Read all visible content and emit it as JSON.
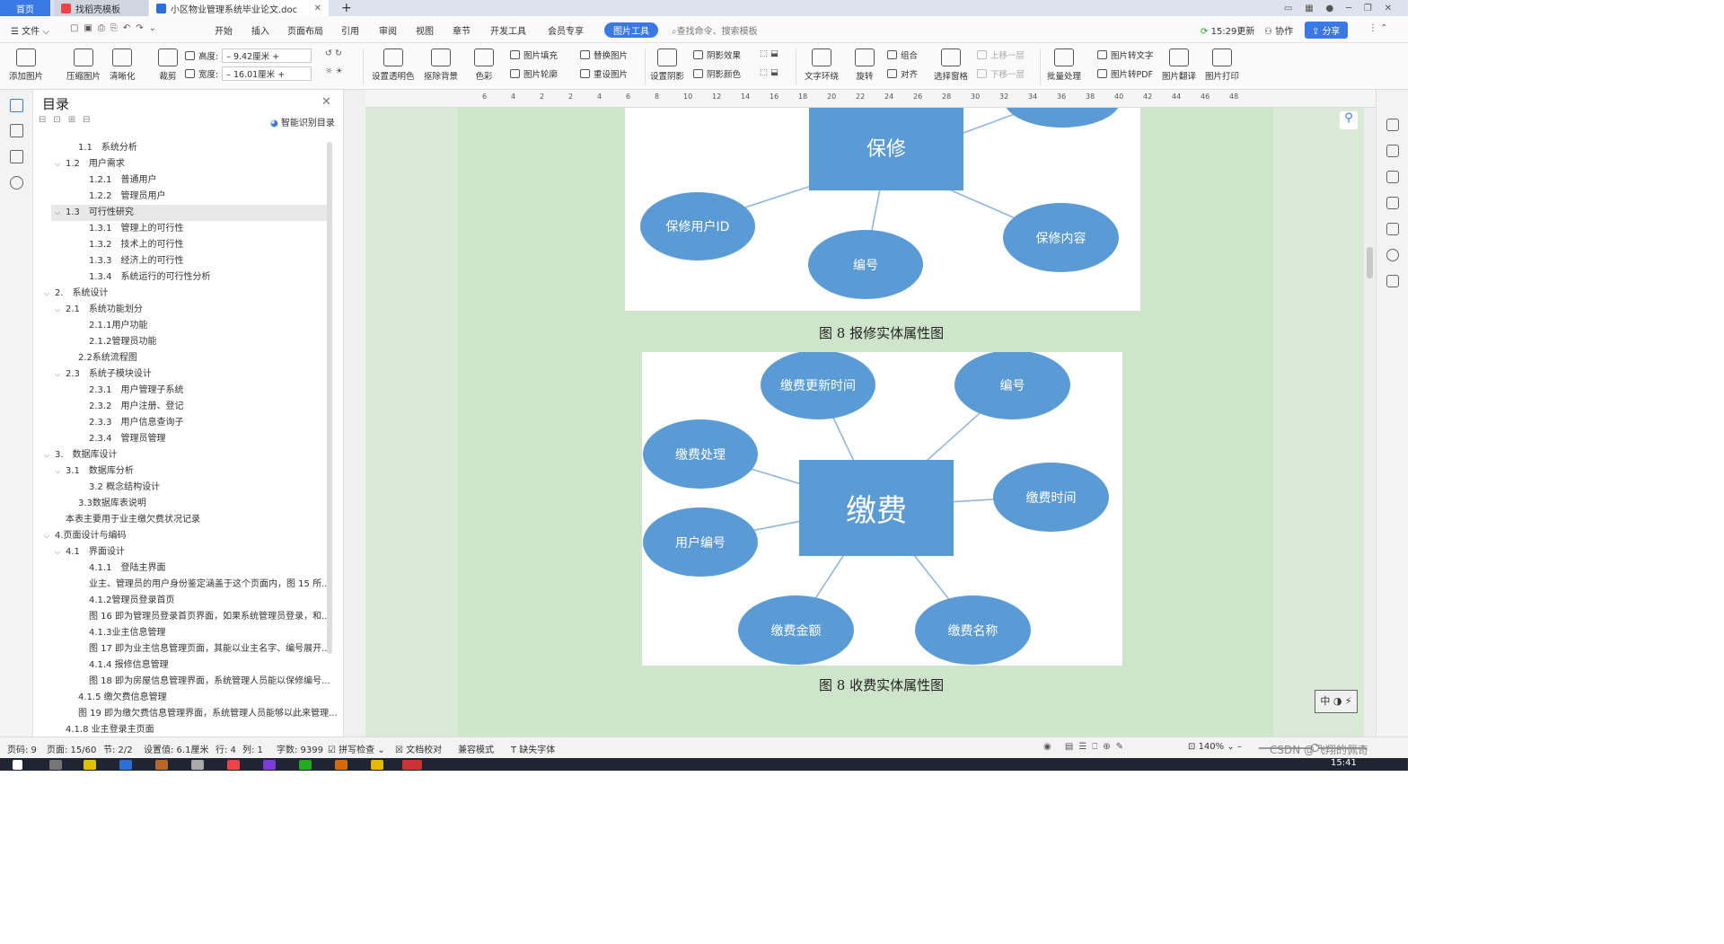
{
  "tabs": {
    "home": "首页",
    "template": "找稻壳模板",
    "document": "小区物业管理系统毕业论文.doc",
    "close": "✕",
    "new": "+"
  },
  "menu": {
    "file": "文件",
    "items": [
      "开始",
      "插入",
      "页面布局",
      "引用",
      "审阅",
      "视图",
      "章节",
      "开发工具",
      "会员专享"
    ],
    "active": "图片工具",
    "search_placeholder": "查找命令、搜索模板",
    "update": "15:29更新",
    "collab": "协作",
    "share": "分享"
  },
  "ribbon": {
    "big": [
      "添加图片",
      "压缩图片",
      "清晰化",
      "裁剪",
      "设置透明色",
      "抠除背景",
      "色彩",
      "设置阴影",
      "文字环绕",
      "旋转",
      "选择窗格",
      "批量处理",
      "图片转文字",
      "图片翻译",
      "图片打印"
    ],
    "height_label": "高度:",
    "height_value": "9.42厘米",
    "width_label": "宽度:",
    "width_value": "16.01厘米",
    "small": [
      "图片填充",
      "图片轮廓",
      "替换图片",
      "重设图片",
      "阴影效果",
      "阴影颜色",
      "组合",
      "对齐",
      "上移一层",
      "下移一层",
      "图片转PDF"
    ]
  },
  "toc": {
    "title": "目录",
    "smart": "智能识别目录",
    "items": [
      {
        "text": "1.1　系统分析",
        "arrow": ""
      },
      {
        "text": "1.2　用户需求",
        "arrow": "v"
      },
      {
        "text": "1.2.1　普通用户",
        "arrow": ""
      },
      {
        "text": "1.2.2　管理员用户",
        "arrow": ""
      },
      {
        "text": "1.3　可行性研究",
        "arrow": "v"
      },
      {
        "text": "1.3.1　管理上的可行性",
        "arrow": ""
      },
      {
        "text": "1.3.2　技术上的可行性",
        "arrow": ""
      },
      {
        "text": "1.3.3　经济上的可行性",
        "arrow": ""
      },
      {
        "text": "1.3.4　系统运行的可行性分析",
        "arrow": ""
      },
      {
        "text": "2.　系统设计",
        "arrow": "v"
      },
      {
        "text": "2.1　系统功能划分",
        "arrow": "v"
      },
      {
        "text": "2.1.1用户功能",
        "arrow": ""
      },
      {
        "text": "2.1.2管理员功能",
        "arrow": ""
      },
      {
        "text": "2.2系统流程图",
        "arrow": ""
      },
      {
        "text": "2.3　系统子模块设计",
        "arrow": "v"
      },
      {
        "text": "2.3.1　用户管理子系统",
        "arrow": ""
      },
      {
        "text": "2.3.2　用户注册、登记",
        "arrow": ""
      },
      {
        "text": "2.3.3　用户信息查询子",
        "arrow": ""
      },
      {
        "text": "2.3.4　管理员管理",
        "arrow": ""
      },
      {
        "text": "3.　数据库设计",
        "arrow": "v"
      },
      {
        "text": "3.1　数据库分析",
        "arrow": "v"
      },
      {
        "text": "3.2 概念结构设计",
        "arrow": ""
      },
      {
        "text": "3.3数据库表说明",
        "arrow": ""
      },
      {
        "text": "本表主要用于业主缴欠费状况记录",
        "arrow": ""
      },
      {
        "text": "4.页面设计与编码",
        "arrow": "v"
      },
      {
        "text": "4.1　界面设计",
        "arrow": "v"
      },
      {
        "text": "4.1.1　登陆主界面",
        "arrow": ""
      },
      {
        "text": "业主、管理员的用户身份鉴定涵盖于这个页面内，图 15 所...",
        "arrow": ""
      },
      {
        "text": "4.1.2管理员登录首页",
        "arrow": ""
      },
      {
        "text": "图 16 即为管理员登录首页界面，如果系统管理员登录，和...",
        "arrow": ""
      },
      {
        "text": "4.1.3业主信息管理",
        "arrow": ""
      },
      {
        "text": "图 17 即为业主信息管理页面，其能以业主名字、编号展开...",
        "arrow": ""
      },
      {
        "text": "4.1.4 报修信息管理",
        "arrow": ""
      },
      {
        "text": "图 18 即为房屋信息管理界面，系统管理人员能以保修编号...",
        "arrow": ""
      },
      {
        "text": "4.1.5 缴欠费信息管理",
        "arrow": ""
      },
      {
        "text": "图 19 即为缴欠费信息管理界面，系统管理人员能够以此来管理...",
        "arrow": ""
      },
      {
        "text": "4.1.8 业主登录主页面",
        "arrow": ""
      }
    ]
  },
  "ruler": [
    "6",
    "4",
    "2",
    "2",
    "4",
    "6",
    "8",
    "10",
    "12",
    "14",
    "16",
    "18",
    "20",
    "22",
    "24",
    "26",
    "28",
    "30",
    "32",
    "34",
    "36",
    "38",
    "40",
    "42",
    "44",
    "46",
    "48"
  ],
  "fig1": {
    "entity": "保修",
    "attrs": [
      "保修用户ID",
      "编号",
      "保修内容"
    ],
    "caption": "图 8 报修实体属性图"
  },
  "fig2": {
    "entity": "缴费",
    "attrs": [
      "缴费更新时间",
      "编号",
      "缴费处理",
      "缴费时间",
      "用户编号",
      "缴费金额",
      "缴费名称"
    ],
    "caption": "图 8 收费实体属性图"
  },
  "status": {
    "page_no": "页码: 9",
    "pages": "页面: 15/60",
    "section": "节: 2/2",
    "setting": "设置值: 6.1厘米",
    "row": "行: 4",
    "col": "列: 1",
    "words": "字数: 9399",
    "spell": "拼写检查",
    "proof": "文档校对",
    "compat": "兼容模式",
    "font": "缺失字体",
    "zoom": "140%",
    "watermark": "CSDN @飞翔的佩奇",
    "time": "15:41"
  },
  "colors": {
    "accent": "#3a78e6",
    "node": "#5b9bd5",
    "page": "#cfe5cb"
  }
}
